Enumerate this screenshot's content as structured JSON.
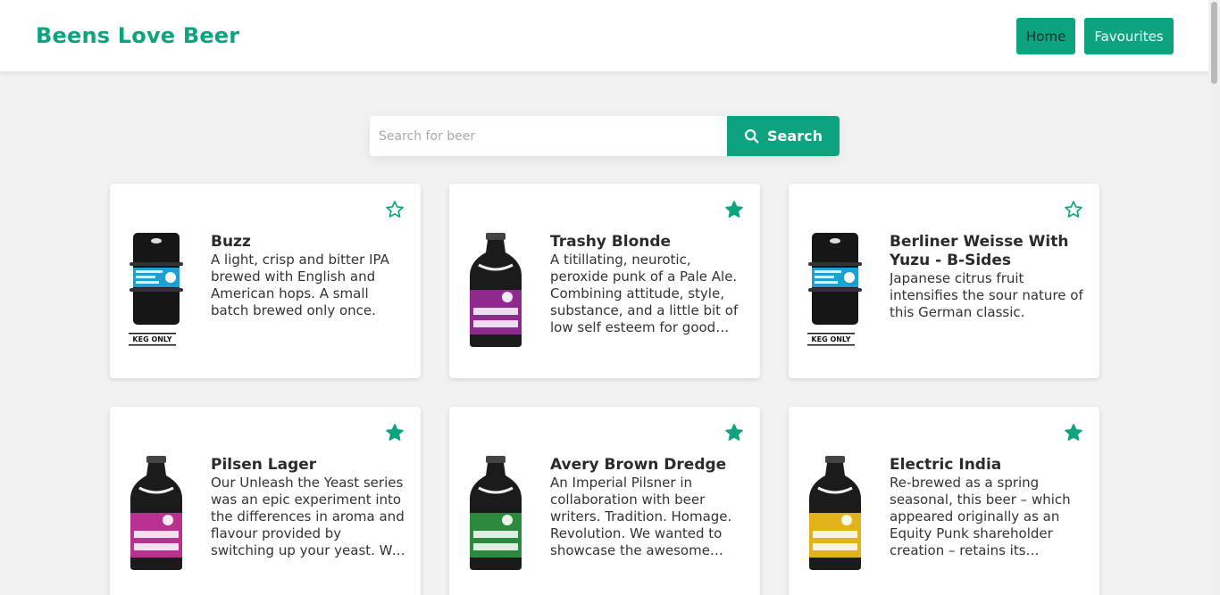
{
  "header": {
    "brand": "Beens Love Beer",
    "nav": [
      {
        "label": "Home"
      },
      {
        "label": "Favourites"
      }
    ]
  },
  "search": {
    "placeholder": "Search for beer",
    "value": "",
    "button_label": "Search",
    "icon": "search-icon"
  },
  "colors": {
    "accent": "#0da37f",
    "background": "#f2f2f2",
    "card": "#ffffff"
  },
  "beers": [
    {
      "name": "Buzz",
      "description": "A light, crisp and bitter IPA brewed with English and American hops. A small batch brewed only once.",
      "favourite": false,
      "image": "keg",
      "label_color": "#1fa0d2",
      "image_text": "KEG ONLY"
    },
    {
      "name": "Trashy Blonde",
      "description": "A titillating, neurotic, peroxide punk of a Pale Ale. Combining attitude, style, substance, and a little bit of low self esteem for good…",
      "favourite": true,
      "image": "bottle",
      "label_color": "#8e2a8e"
    },
    {
      "name": "Berliner Weisse With Yuzu - B-Sides",
      "description": "Japanese citrus fruit intensifies the sour nature of this German classic.",
      "favourite": false,
      "image": "keg",
      "label_color": "#1fa0d2",
      "image_text": "KEG ONLY"
    },
    {
      "name": "Pilsen Lager",
      "description": "Our Unleash the Yeast series was an epic experiment into the differences in aroma and flavour provided by switching up your yeast. We brewed …",
      "favourite": true,
      "image": "bottle",
      "label_color": "#b8318f"
    },
    {
      "name": "Avery Brown Dredge",
      "description": "An Imperial Pilsner in collaboration with beer writers. Tradition. Homage. Revolution. We wanted to showcase the awesome…",
      "favourite": true,
      "image": "bottle",
      "label_color": "#2b8a3e"
    },
    {
      "name": "Electric India",
      "description": "Re-brewed as a spring seasonal, this beer – which appeared originally as an Equity Punk shareholder creation – retains its…",
      "favourite": true,
      "image": "bottle",
      "label_color": "#e2b21a"
    }
  ]
}
